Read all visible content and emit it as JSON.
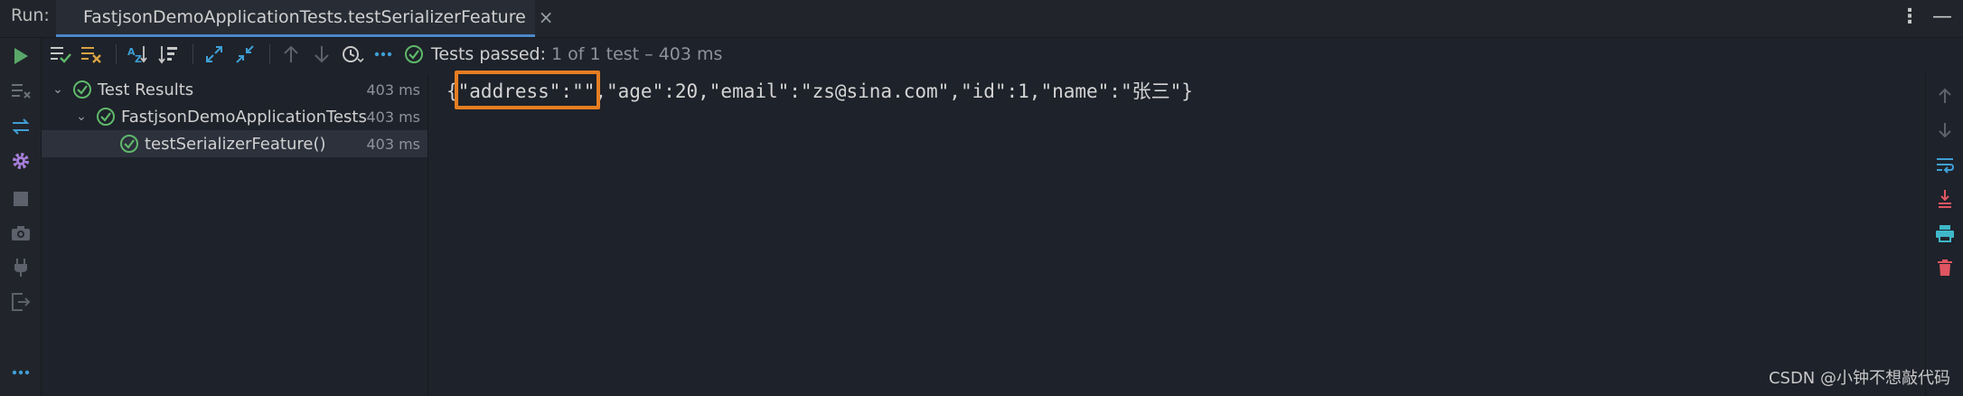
{
  "window": {
    "run_label": "Run:",
    "tab_title": "FastjsonDemoApplicationTests.testSerializerFeature",
    "tab_close": "×",
    "more_icon": "⋮",
    "minimize_icon": "—"
  },
  "toolbar": {
    "status_text": "Tests passed:",
    "status_detail": "1 of 1 test – 403 ms",
    "colors": {
      "pass": "#5fb86b",
      "run": "#59a869",
      "accent": "#d9a343"
    }
  },
  "tree": {
    "rows": [
      {
        "label": "Test Results",
        "time": "403 ms",
        "chevron": "⌄"
      },
      {
        "label": "FastjsonDemoApplicationTests",
        "time": "403 ms",
        "chevron": "⌄"
      },
      {
        "label": "testSerializerFeature()",
        "time": "403 ms",
        "chevron": ""
      }
    ]
  },
  "console": {
    "output_line": "{\"address\":\"\",\"age\":20,\"email\":\"zs@sina.com\",\"id\":1,\"name\":\"张三\"}",
    "highlight_color": "#e67e22"
  },
  "watermark": "CSDN @小钟不想敲代码"
}
